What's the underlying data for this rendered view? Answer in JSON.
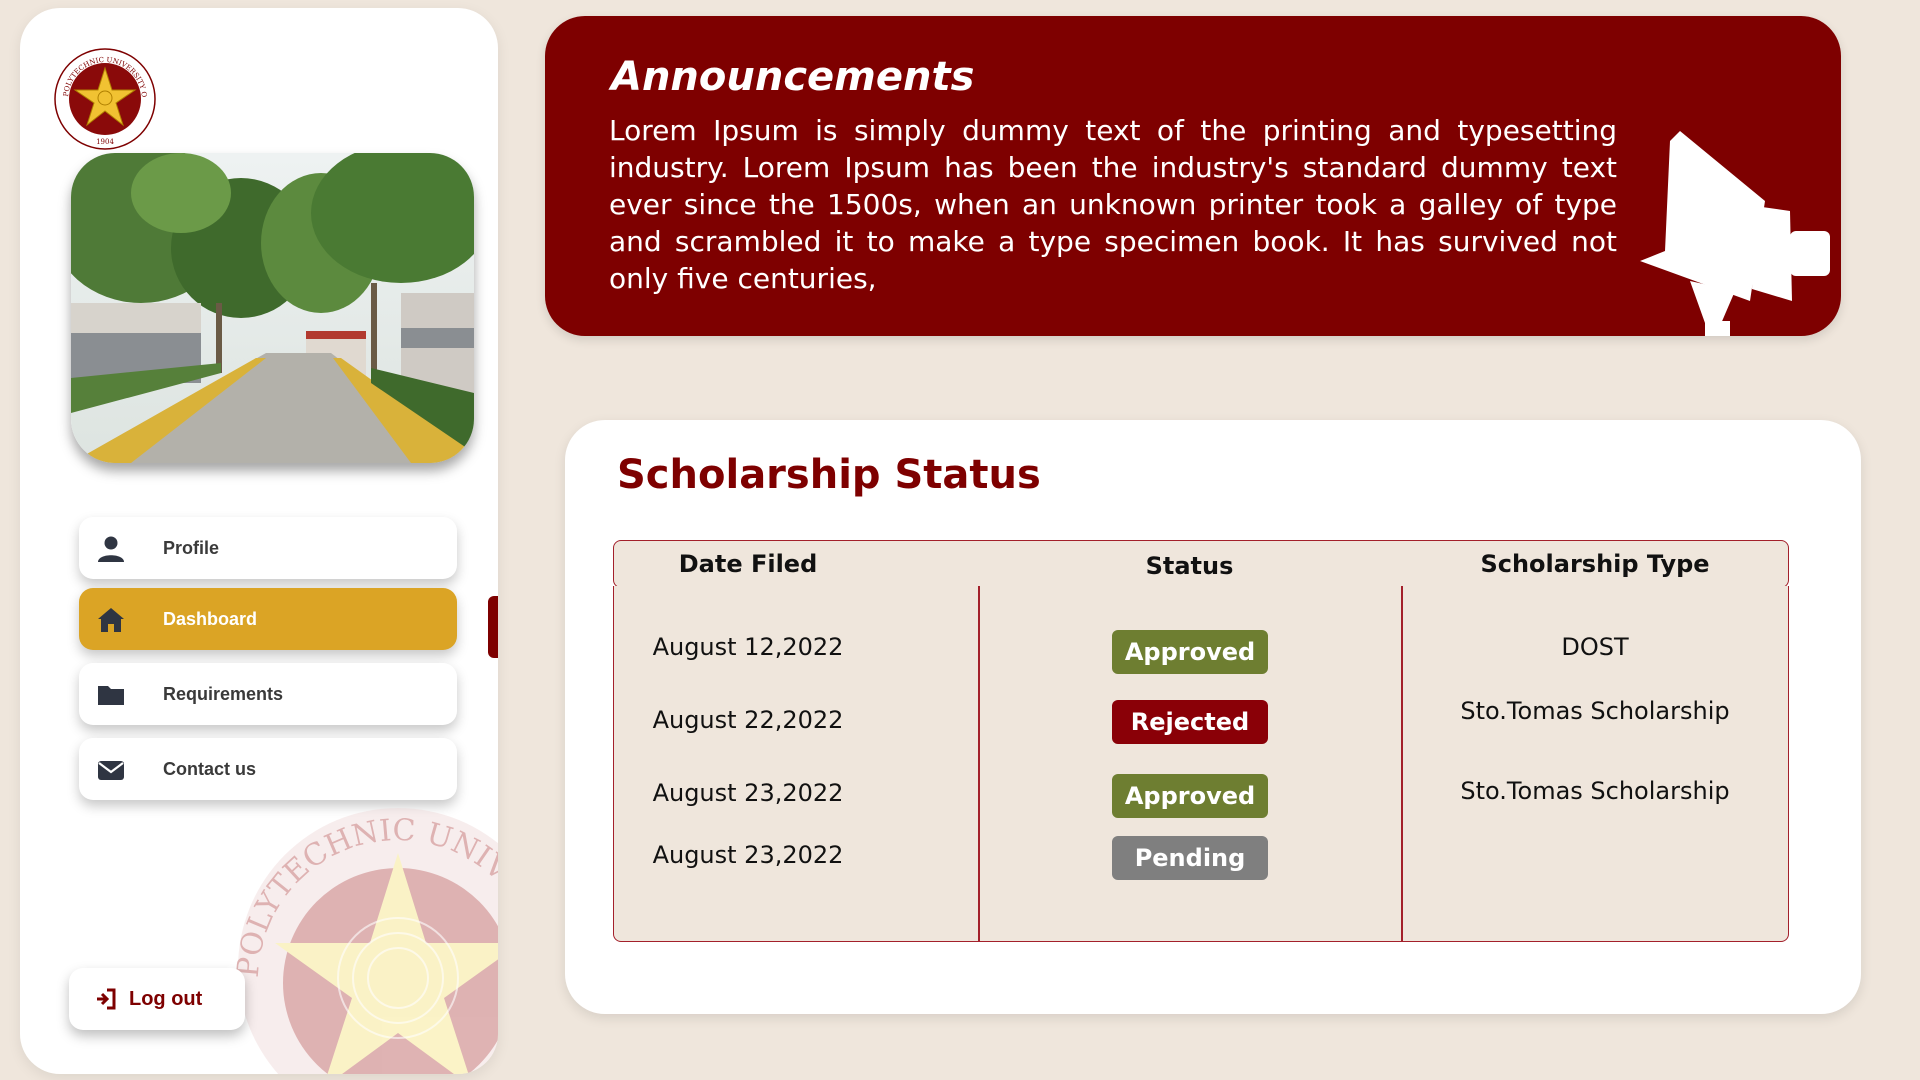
{
  "colors": {
    "maroon": "#7e0000",
    "gold": "#dba425",
    "background": "#efe6dc",
    "approved": "#6e7e31",
    "rejected": "#8a0007",
    "pending": "#7f7f7f"
  },
  "sidebar": {
    "logo_icon": "pup-seal-logo",
    "nav_items": [
      {
        "label": "Profile",
        "icon": "person-icon",
        "active": false
      },
      {
        "label": "Dashboard",
        "icon": "home-icon",
        "active": true
      },
      {
        "label": "Requirements",
        "icon": "folder-icon",
        "active": false
      },
      {
        "label": "Contact us",
        "icon": "envelope-icon",
        "active": false
      }
    ],
    "logout_label": "Log out",
    "logout_icon": "logout-icon",
    "seal_lettering": "POLYTECHNIC UNIVERSITY OF THE PHILIPPINES",
    "seal_year": "1904"
  },
  "announcements": {
    "title": "Announcements",
    "body": "Lorem Ipsum is simply dummy text of the printing and typesetting industry. Lorem Ipsum has been the industry's standard dummy text ever since the 1500s, when an unknown printer took a galley of type and scrambled it to make a type specimen book. It has survived not only five centuries,",
    "icon": "megaphone-icon"
  },
  "scholarship": {
    "title": "Scholarship Status",
    "headers": {
      "date": "Date Filed",
      "status": "Status",
      "type": "Scholarship Type"
    },
    "rows": [
      {
        "date": "August 12,2022",
        "status": "Approved",
        "type": "DOST"
      },
      {
        "date": "August 22,2022",
        "status": "Rejected",
        "type": "Sto.Tomas Scholarship"
      },
      {
        "date": "August 23,2022",
        "status": "Approved",
        "type": "Sto.Tomas Scholarship"
      },
      {
        "date": "August 23,2022",
        "status": "Pending",
        "type": ""
      }
    ]
  }
}
